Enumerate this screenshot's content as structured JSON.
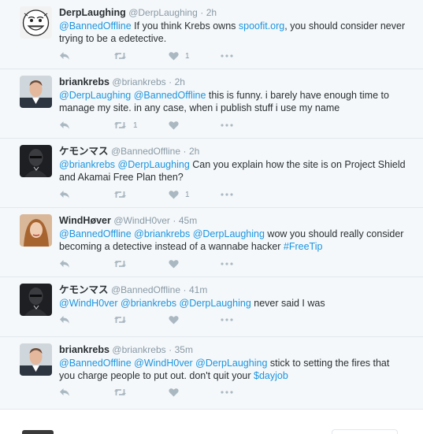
{
  "tweets": [
    {
      "name": "DerpLaughing",
      "handle": "@DerpLaughing",
      "time": "2h",
      "avatar": "rage-comic-face",
      "parts": [
        {
          "t": "@BannedOffline",
          "link": true
        },
        {
          "t": " If you think Krebs owns ",
          "link": false
        },
        {
          "t": "spoofit.org",
          "link": true
        },
        {
          "t": ", you should consider never trying to be a edetective.",
          "link": false
        }
      ],
      "retweets": "",
      "likes": "1"
    },
    {
      "name": "briankrebs",
      "handle": "@briankrebs",
      "time": "2h",
      "avatar": "man-in-suit-photo",
      "parts": [
        {
          "t": "@DerpLaughing",
          "link": true
        },
        {
          "t": " ",
          "link": false
        },
        {
          "t": "@BannedOffline",
          "link": true
        },
        {
          "t": " this is funny. i barely have enough time to manage my site. in any case, when i publish stuff i use my name",
          "link": false
        }
      ],
      "retweets": "1",
      "likes": ""
    },
    {
      "name": "ケモンマス",
      "handle": "@BannedOffline",
      "time": "2h",
      "avatar": "masked-figure-photo",
      "parts": [
        {
          "t": "@briankrebs",
          "link": true
        },
        {
          "t": " ",
          "link": false
        },
        {
          "t": "@DerpLaughing",
          "link": true
        },
        {
          "t": " Can you explain how the site is on Project Shield and Akamai Free Plan then?",
          "link": false
        }
      ],
      "retweets": "",
      "likes": "1"
    },
    {
      "name": "WindHøver",
      "handle": "@WindH0ver",
      "time": "45m",
      "avatar": "woman-photo",
      "parts": [
        {
          "t": "@BannedOffline",
          "link": true
        },
        {
          "t": " ",
          "link": false
        },
        {
          "t": "@briankrebs",
          "link": true
        },
        {
          "t": " ",
          "link": false
        },
        {
          "t": "@DerpLaughing",
          "link": true
        },
        {
          "t": " wow you should really consider becoming a detective instead of a wannabe hacker ",
          "link": false
        },
        {
          "t": "#FreeTip",
          "link": true
        }
      ],
      "retweets": "",
      "likes": ""
    },
    {
      "name": "ケモンマス",
      "handle": "@BannedOffline",
      "time": "41m",
      "avatar": "masked-figure-photo",
      "parts": [
        {
          "t": "@WindH0ver",
          "link": true
        },
        {
          "t": " ",
          "link": false
        },
        {
          "t": "@briankrebs",
          "link": true
        },
        {
          "t": " ",
          "link": false
        },
        {
          "t": "@DerpLaughing",
          "link": true
        },
        {
          "t": " never said I was",
          "link": false
        }
      ],
      "retweets": "",
      "likes": ""
    },
    {
      "name": "briankrebs",
      "handle": "@briankrebs",
      "time": "35m",
      "avatar": "man-in-suit-photo",
      "parts": [
        {
          "t": "@BannedOffline",
          "link": true
        },
        {
          "t": " ",
          "link": false
        },
        {
          "t": "@WindH0ver",
          "link": true
        },
        {
          "t": " ",
          "link": false
        },
        {
          "t": "@DerpLaughing",
          "link": true
        },
        {
          "t": " stick to setting the fires that you charge people to put out. don't quit your ",
          "link": false
        },
        {
          "t": "$dayjob",
          "link": true
        }
      ],
      "retweets": "",
      "likes": ""
    }
  ],
  "ui": {
    "separator": "·",
    "icons": {
      "reply": "reply-icon",
      "retweet": "retweet-icon",
      "like": "heart-icon",
      "more": "more-icon"
    },
    "colors": {
      "link": "#1b95e0",
      "muted": "#8899a6",
      "icon": "#aab8c2"
    }
  }
}
